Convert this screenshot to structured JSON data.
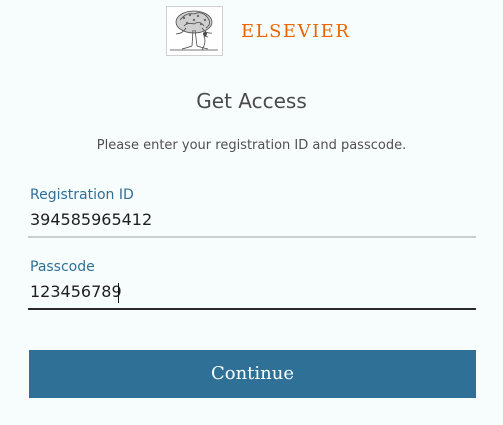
{
  "logo": {
    "icon": "elsevier-tree-icon",
    "brand_text": "ELSEVIER",
    "brand_color": "#eb6500"
  },
  "page": {
    "title": "Get Access",
    "subtitle": "Please enter your registration ID and passcode."
  },
  "form": {
    "registration_id": {
      "label": "Registration ID",
      "value": "394585965412"
    },
    "passcode": {
      "label": "Passcode",
      "value": "123456789"
    },
    "continue_label": "Continue"
  },
  "colors": {
    "accent": "#2e7096",
    "background": "#f7fcfd"
  }
}
